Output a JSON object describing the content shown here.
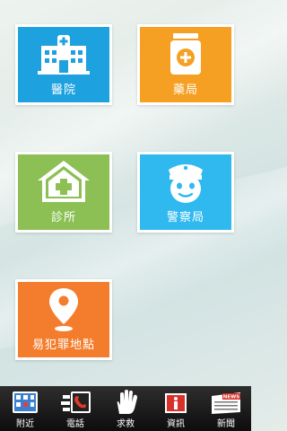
{
  "tiles": {
    "hospital": {
      "label": "醫院",
      "icon": "hospital-icon",
      "color": "#1da1df"
    },
    "pharmacy": {
      "label": "藥局",
      "icon": "medicine-bottle-icon",
      "color": "#f6a023"
    },
    "clinic": {
      "label": "診所",
      "icon": "clinic-icon",
      "color": "#8cc055"
    },
    "police": {
      "label": "警察局",
      "icon": "police-officer-icon",
      "color": "#2fb9ef"
    },
    "crime_spot": {
      "label": "易犯罪地點",
      "icon": "location-pin-icon",
      "color": "#f47d2d"
    }
  },
  "bottom_nav": {
    "nearby": {
      "label": "附近",
      "icon": "nearby-icon"
    },
    "phone": {
      "label": "電話",
      "icon": "phone-icon"
    },
    "help": {
      "label": "求救",
      "icon": "hand-icon"
    },
    "info": {
      "label": "資訊",
      "icon": "info-icon"
    },
    "news": {
      "label": "新聞",
      "icon": "news-icon",
      "icon_text": "NEWS"
    }
  }
}
